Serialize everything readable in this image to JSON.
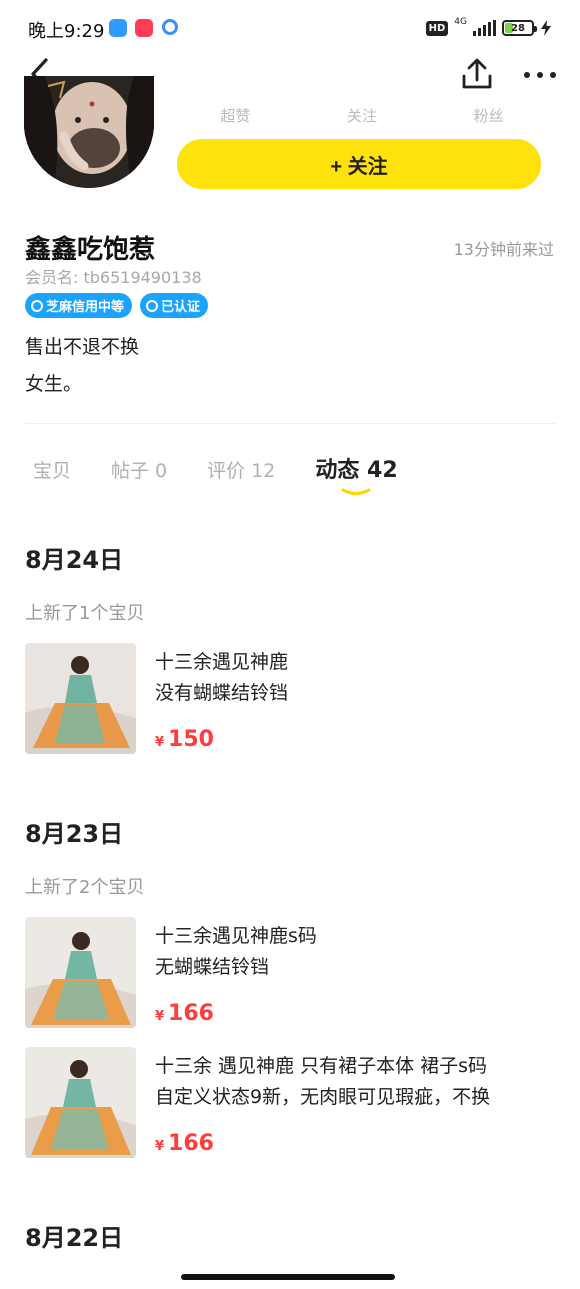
{
  "status_bar": {
    "time": "晚上9:29",
    "hd": "HD",
    "network": "4G",
    "battery": "28"
  },
  "profile": {
    "stats": [
      {
        "label": "超赞"
      },
      {
        "label": "关注"
      },
      {
        "label": "粉丝"
      }
    ],
    "follow_label": "+ 关注",
    "nickname": "鑫鑫吃饱惹",
    "last_seen": "13分钟前来过",
    "member_id": "会员名: tb6519490138",
    "badges": {
      "credit": "芝麻信用中等",
      "verified": "已认证"
    },
    "bio": [
      "售出不退不换",
      "女生。"
    ]
  },
  "tabs": [
    {
      "label": "宝贝"
    },
    {
      "label": "帖子 0"
    },
    {
      "label": "评价 12"
    },
    {
      "label": "动态 42"
    }
  ],
  "feed": [
    {
      "date": "8月24日",
      "summary": "上新了1个宝贝",
      "items": [
        {
          "title": "十三余遇见神鹿\n没有蝴蝶结铃铛",
          "currency": "¥",
          "price": "150"
        }
      ]
    },
    {
      "date": "8月23日",
      "summary": "上新了2个宝贝",
      "items": [
        {
          "title": "十三余遇见神鹿s码\n无蝴蝶结铃铛",
          "currency": "¥",
          "price": "166"
        },
        {
          "title": "十三余 遇见神鹿  只有裙子本体 裙子s码\n自定义状态9新，无肉眼可见瑕疵，不换",
          "currency": "¥",
          "price": "166"
        }
      ]
    },
    {
      "date": "8月22日",
      "summary": "",
      "items": []
    }
  ],
  "colors": {
    "accent_yellow": "#ffe20b",
    "badge_blue": "#1aa3ff",
    "price_red": "#ff3d3d"
  }
}
